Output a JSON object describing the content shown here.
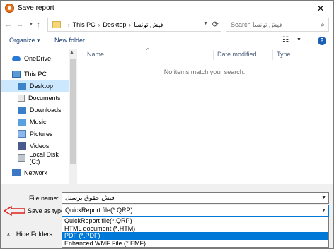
{
  "window": {
    "title": "Save report"
  },
  "address": {
    "crumbs": [
      "This PC",
      "Desktop",
      "فيش تونسا"
    ],
    "search_placeholder": "Search فيش تونسا"
  },
  "toolbar": {
    "organize": "Organize ▾",
    "new_folder": "New folder"
  },
  "nav": {
    "items": [
      {
        "label": "OneDrive",
        "icon": "onedrive-icon"
      },
      {
        "label": "This PC",
        "icon": "computer-icon"
      },
      {
        "label": "Desktop",
        "icon": "desktop-icon",
        "selected": true
      },
      {
        "label": "Documents",
        "icon": "documents-icon"
      },
      {
        "label": "Downloads",
        "icon": "downloads-icon"
      },
      {
        "label": "Music",
        "icon": "music-icon"
      },
      {
        "label": "Pictures",
        "icon": "pictures-icon"
      },
      {
        "label": "Videos",
        "icon": "videos-icon"
      },
      {
        "label": "Local Disk (C:)",
        "icon": "disk-icon"
      },
      {
        "label": "Network",
        "icon": "network-icon"
      }
    ]
  },
  "filelist": {
    "columns": [
      "Name",
      "Date modified",
      "Type"
    ],
    "empty_message": "No items match your search."
  },
  "form": {
    "file_name_label": "File name:",
    "file_name_value": "فيش حقوق برسنل",
    "save_type_label": "Save as type:",
    "save_type_value": "QuickReport file(*.QRP)",
    "type_options": [
      "QuickReport file(*.QRP)",
      "HTML document (*.HTM)",
      "PDF (*.PDF)",
      "Enhanced WMF File (*.EMF)"
    ],
    "highlighted_option_index": 2
  },
  "footer": {
    "hide_folders": "Hide Folders"
  },
  "colors": {
    "selection": "#cce8ff",
    "highlight": "#0078d7",
    "arrow": "#e02020"
  }
}
